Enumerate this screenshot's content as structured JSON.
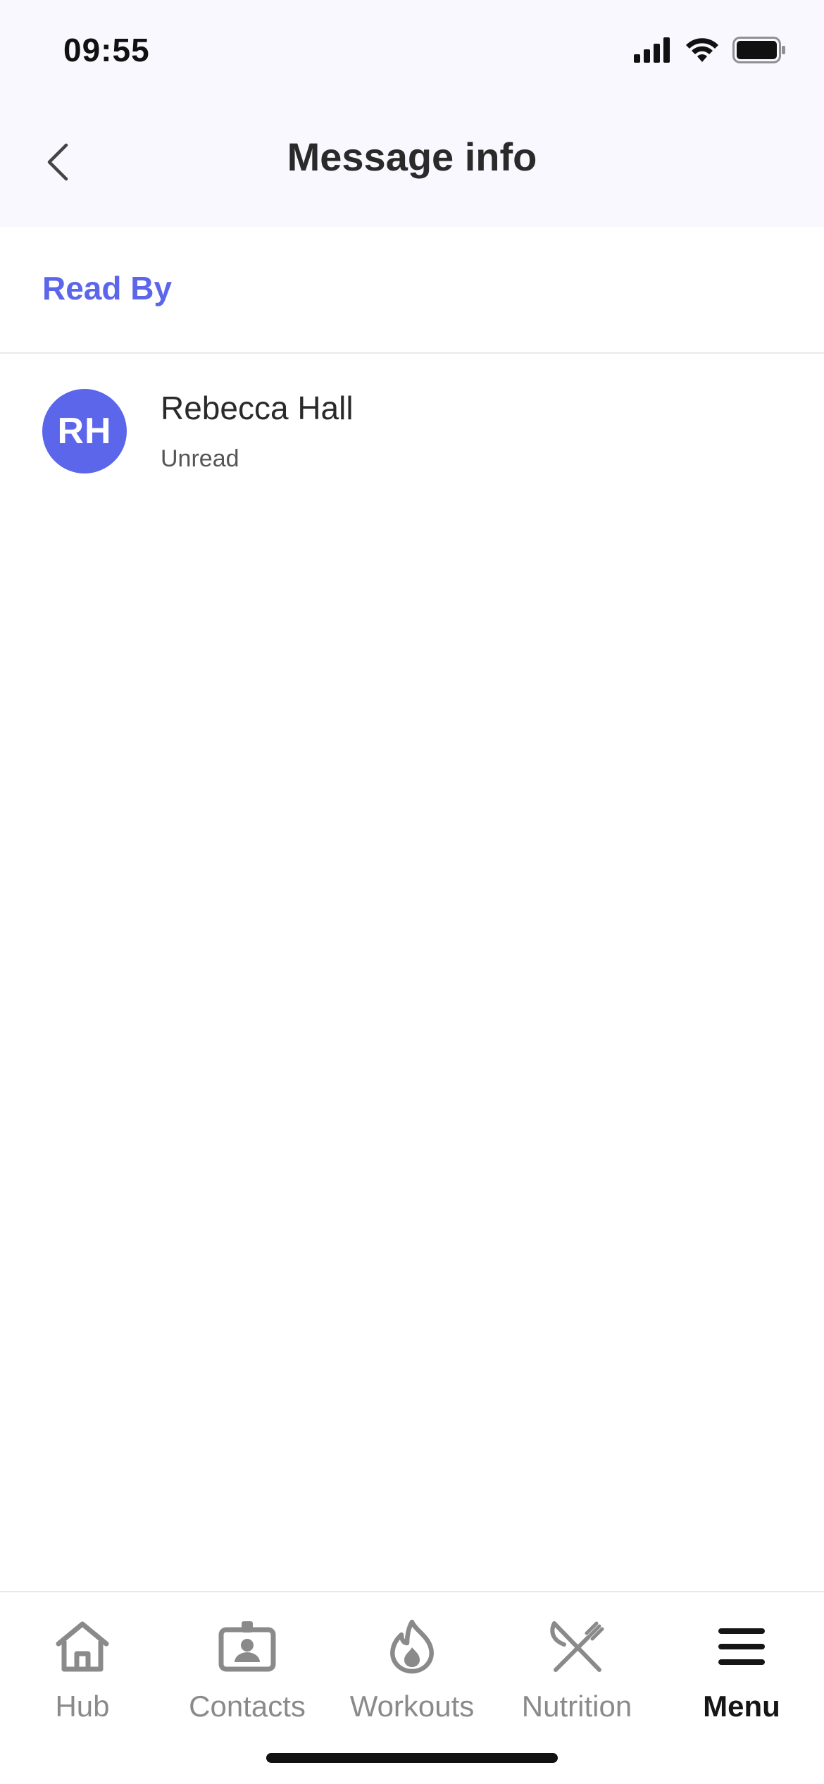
{
  "status_bar": {
    "time": "09:55",
    "icons": [
      "cellular-signal-icon",
      "wifi-icon",
      "battery-icon"
    ]
  },
  "header": {
    "title": "Message info",
    "back_icon": "chevron-left-icon"
  },
  "section": {
    "title": "Read By"
  },
  "readers": [
    {
      "initials": "RH",
      "name": "Rebecca Hall",
      "status": "Unread"
    }
  ],
  "bottom_nav": {
    "items": [
      {
        "label": "Hub",
        "icon": "home-icon",
        "active": false
      },
      {
        "label": "Contacts",
        "icon": "contact-card-icon",
        "active": false
      },
      {
        "label": "Workouts",
        "icon": "flame-icon",
        "active": false
      },
      {
        "label": "Nutrition",
        "icon": "fork-knife-icon",
        "active": false
      },
      {
        "label": "Menu",
        "icon": "hamburger-menu-icon",
        "active": true
      }
    ]
  },
  "colors": {
    "accent": "#5b66ea",
    "header_bg": "#f8f8fe",
    "nav_inactive": "#8a8a8a",
    "nav_active": "#151515"
  }
}
